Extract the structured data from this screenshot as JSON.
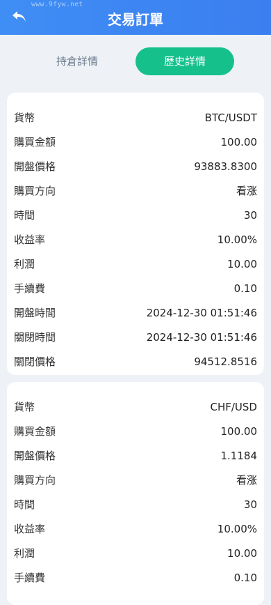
{
  "header": {
    "title": "交易訂單",
    "watermark": "www.9fyw.net"
  },
  "tabs": [
    {
      "label": "持倉詳情"
    },
    {
      "label": "歷史詳情"
    }
  ],
  "orders": [
    {
      "rows": [
        {
          "label": "貨幣",
          "value": "BTC/USDT"
        },
        {
          "label": "購買金額",
          "value": "100.00"
        },
        {
          "label": "開盤價格",
          "value": "93883.8300"
        },
        {
          "label": "購買方向",
          "value": "看涨"
        },
        {
          "label": "時間",
          "value": "30"
        },
        {
          "label": "收益率",
          "value": "10.00%"
        },
        {
          "label": "利潤",
          "value": "10.00"
        },
        {
          "label": "手續費",
          "value": "0.10"
        },
        {
          "label": "開盤時間",
          "value": "2024-12-30 01:51:46"
        },
        {
          "label": "關閉時間",
          "value": "2024-12-30 01:51:46"
        },
        {
          "label": "關閉價格",
          "value": "94512.8516"
        }
      ]
    },
    {
      "rows": [
        {
          "label": "貨幣",
          "value": "CHF/USD"
        },
        {
          "label": "購買金額",
          "value": "100.00"
        },
        {
          "label": "開盤價格",
          "value": "1.1184"
        },
        {
          "label": "購買方向",
          "value": "看涨"
        },
        {
          "label": "時間",
          "value": "30"
        },
        {
          "label": "收益率",
          "value": "10.00%"
        },
        {
          "label": "利潤",
          "value": "10.00"
        },
        {
          "label": "手續費",
          "value": "0.10"
        }
      ]
    }
  ],
  "colors": {
    "header": "#3b82f6",
    "active_tab": "#16c08b",
    "background": "#eef2f7"
  }
}
